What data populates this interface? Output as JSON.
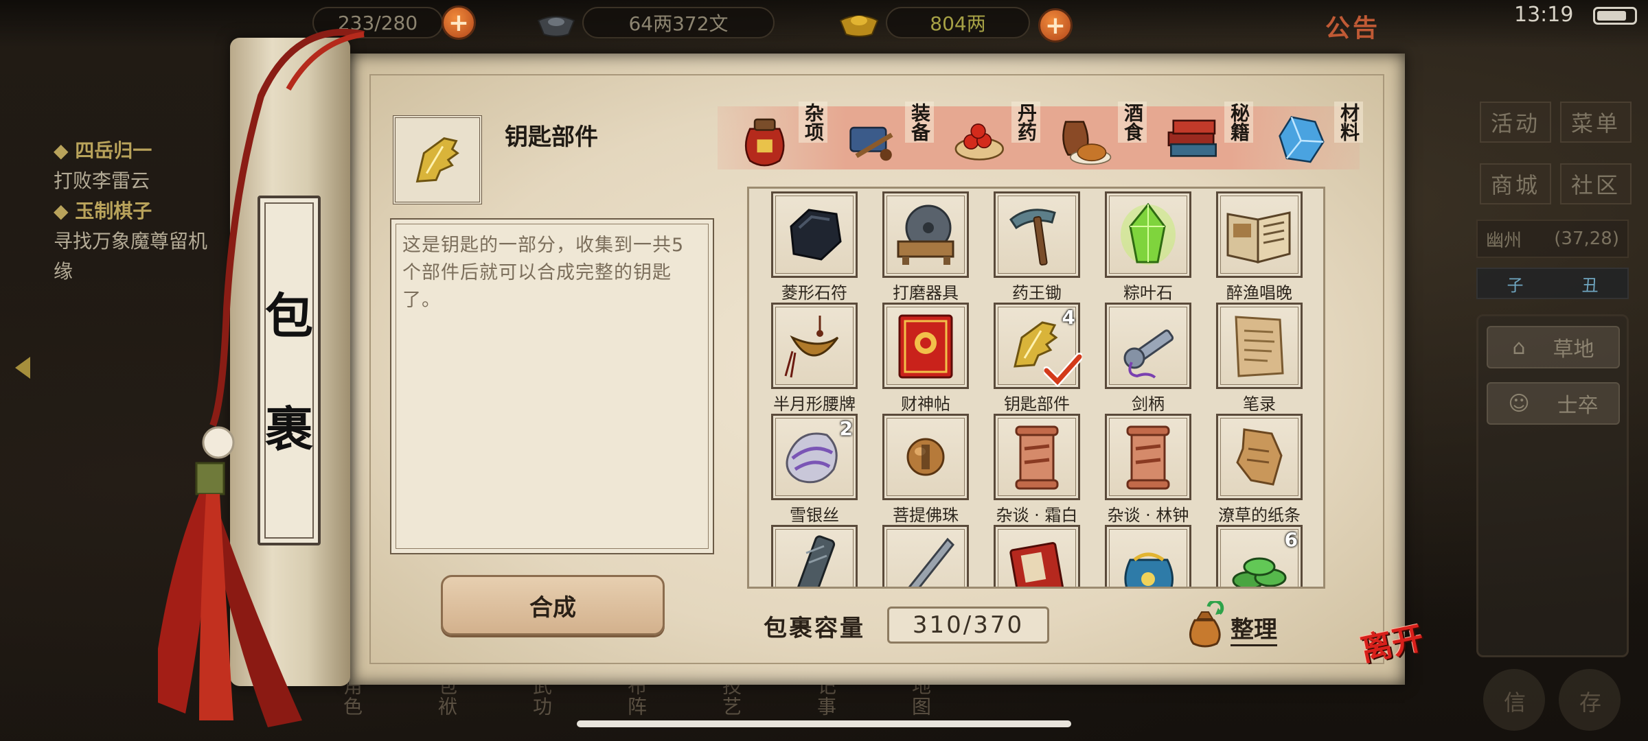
{
  "hud": {
    "stamina": "233/280",
    "silver": "64两372文",
    "gold": "804两",
    "announcement": "公告",
    "time": "13:19",
    "battery_level": 0.8
  },
  "quests": [
    {
      "title": "◆ 四岳归一",
      "desc": "打败李雷云"
    },
    {
      "title": "◆ 玉制棋子",
      "desc": "寻找万象魔尊留机缘"
    }
  ],
  "side_menu": [
    "活动",
    "菜单",
    "商城",
    "社区"
  ],
  "location": {
    "name": "幽州",
    "coords": "(37,28)"
  },
  "zodiac": [
    "子",
    "丑"
  ],
  "terrain_buttons": [
    "草地",
    "士卒"
  ],
  "bottom_nav": [
    "角色",
    "包袱",
    "武功",
    "布阵",
    "技艺",
    "记事",
    "地图"
  ],
  "bottom_right": [
    "信",
    "存"
  ],
  "bag": {
    "title_chars": [
      "包",
      "裹"
    ],
    "selected_item": {
      "name": "钥匙部件",
      "description": "这是钥匙的一部分，收集到一共5个部件后就可以合成完整的钥匙了。"
    },
    "compose_label": "合成",
    "categories": [
      {
        "label": "杂项",
        "icon": "wine-jar-icon",
        "active": true
      },
      {
        "label": "装备",
        "icon": "equipment-icon"
      },
      {
        "label": "丹药",
        "icon": "pills-icon"
      },
      {
        "label": "酒食",
        "icon": "food-icon"
      },
      {
        "label": "秘籍",
        "icon": "book-icon"
      },
      {
        "label": "材料",
        "icon": "crystal-icon"
      }
    ],
    "items": [
      {
        "name": "菱形石符",
        "icon": "stone-icon",
        "count": ""
      },
      {
        "name": "打磨器具",
        "icon": "grindstone-icon",
        "count": ""
      },
      {
        "name": "药王锄",
        "icon": "hoe-icon",
        "count": ""
      },
      {
        "name": "粽叶石",
        "icon": "green-crystal-icon",
        "count": ""
      },
      {
        "name": "醉渔唱晚",
        "icon": "open-book-icon",
        "count": ""
      },
      {
        "name": "半月形腰牌",
        "icon": "waist-token-icon",
        "count": ""
      },
      {
        "name": "财神帖",
        "icon": "red-card-icon",
        "count": ""
      },
      {
        "name": "钥匙部件",
        "icon": "key-part-icon",
        "count": "4",
        "selected": true
      },
      {
        "name": "剑柄",
        "icon": "sword-hilt-icon",
        "count": ""
      },
      {
        "name": "笔录",
        "icon": "paper-note-icon",
        "count": ""
      },
      {
        "name": "雪银丝",
        "icon": "silver-silk-icon",
        "count": "2"
      },
      {
        "name": "菩提佛珠",
        "icon": "bead-icon",
        "count": ""
      },
      {
        "name": "杂谈 · 霜白",
        "icon": "scroll-icon",
        "count": ""
      },
      {
        "name": "杂谈 · 林钟",
        "icon": "scroll-icon",
        "count": ""
      },
      {
        "name": "潦草的纸条",
        "icon": "torn-paper-icon",
        "count": ""
      },
      {
        "name": "",
        "icon": "flute-icon",
        "count": ""
      },
      {
        "name": "",
        "icon": "blade-icon",
        "count": ""
      },
      {
        "name": "",
        "icon": "red-book-icon",
        "count": ""
      },
      {
        "name": "",
        "icon": "pouch-icon",
        "count": ""
      },
      {
        "name": "",
        "icon": "coins-icon",
        "count": "6"
      }
    ],
    "capacity_label": "包裹容量",
    "capacity_value": "310/370",
    "sort_label": "整理",
    "leave_label": "离开"
  },
  "colors": {
    "parchment": "#e4d7be",
    "tab_strip": "#e6a891",
    "accent_red": "#d8201b",
    "check_red": "#d33a1a"
  }
}
